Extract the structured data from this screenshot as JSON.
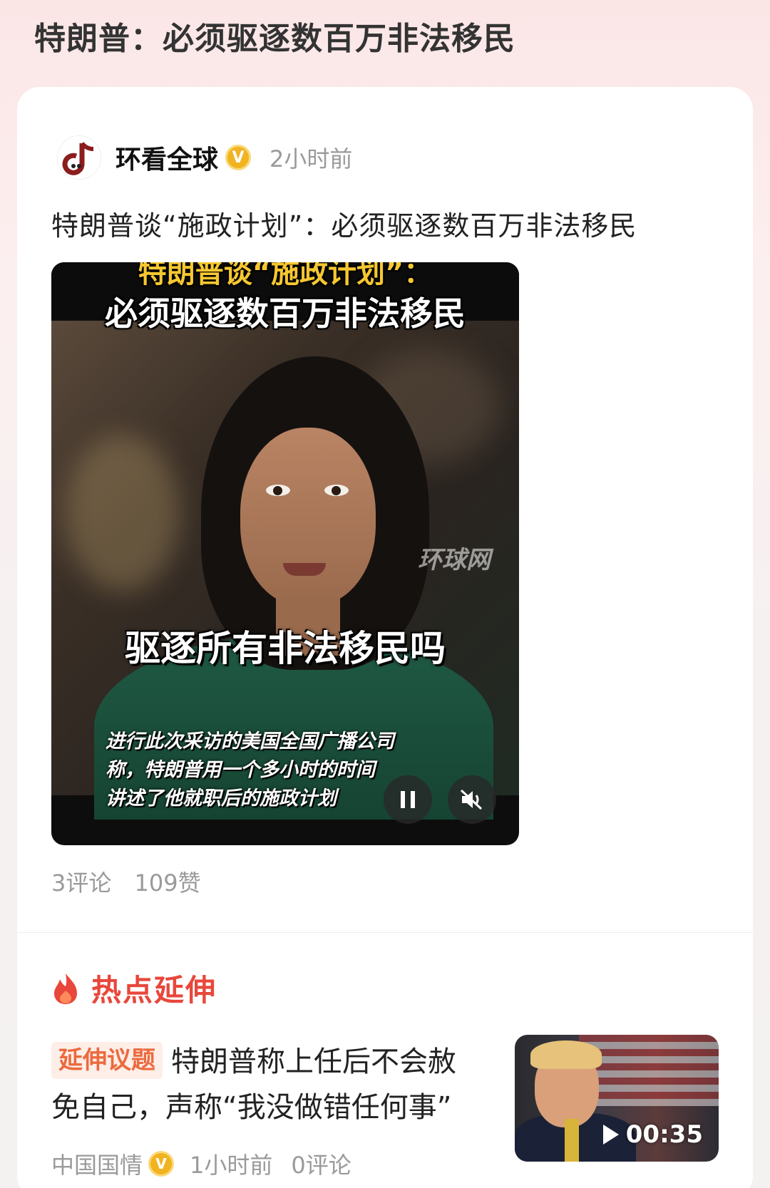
{
  "page": {
    "title": "特朗普：必须驱逐数百万非法移民"
  },
  "post": {
    "author": "环看全球",
    "verified_mark": "V",
    "time": "2小时前",
    "headline": "特朗普谈“施政计划”：必须驱逐数百万非法移民",
    "video": {
      "title_line1": "特朗普谈“施政计划”：",
      "title_line2": "必须驱逐数百万非法移民",
      "caption_big": "驱逐所有非法移民吗",
      "watermark": "环球网",
      "caption_lines": [
        "进行此次采访的美国全国广播公司",
        "称，特朗普用一个多小时的时间",
        "讲述了他就职后的施政计划"
      ],
      "controls": {
        "pause_icon": "pause-icon",
        "mute_icon": "mute-icon"
      }
    },
    "stats": {
      "comments": "3评论",
      "likes": "109赞"
    }
  },
  "hot": {
    "title": "热点延伸",
    "icon": "flame-icon",
    "accent": "#e8473b",
    "item": {
      "tag": "延伸议题",
      "text": "特朗普称上任后不会赦免自己，声称“我没做错任何事”",
      "source": "中国国情",
      "verified_mark": "V",
      "time": "1小时前",
      "comments": "0评论",
      "duration": "00:35"
    }
  }
}
